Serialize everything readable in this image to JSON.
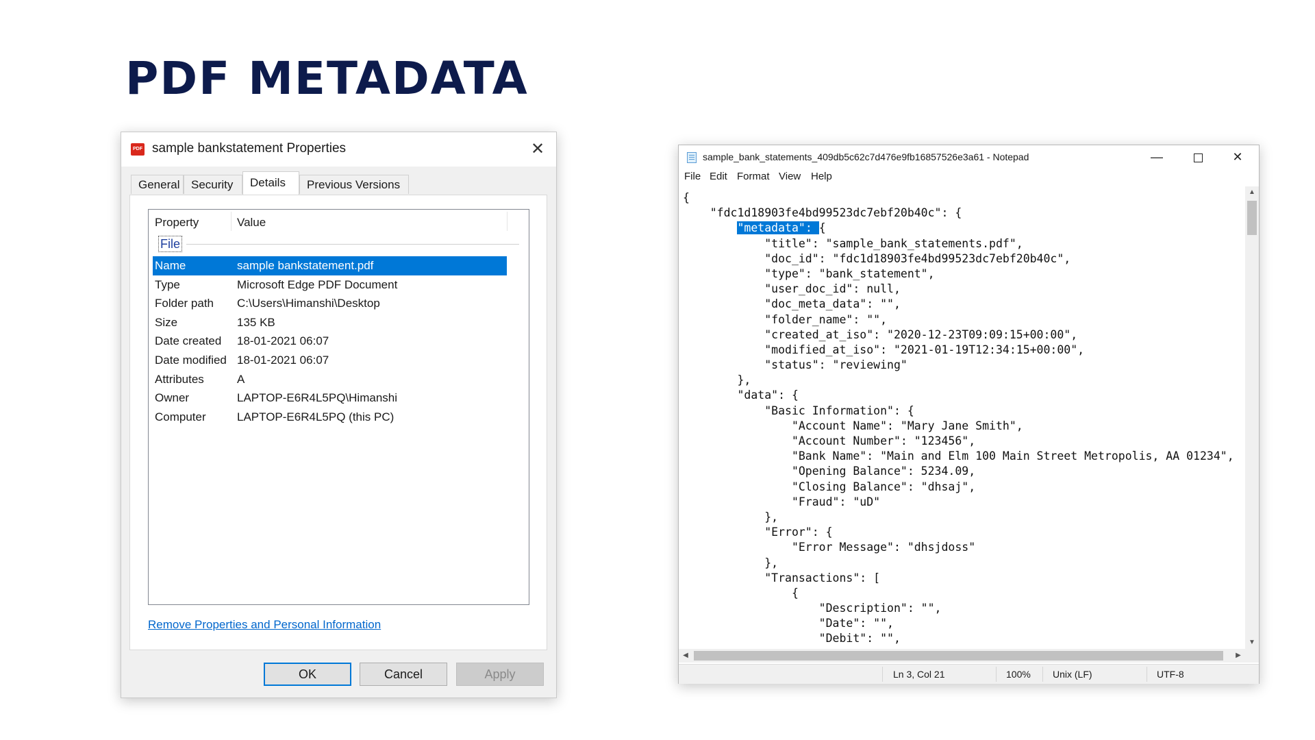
{
  "slide": {
    "title": "PDF METADATA"
  },
  "properties_dialog": {
    "icon_label": "PDF",
    "title": "sample bankstatement Properties",
    "close_glyph": "✕",
    "tabs": [
      "General",
      "Security",
      "Details",
      "Previous Versions"
    ],
    "active_tab": "Details",
    "columns": {
      "property": "Property",
      "value": "Value"
    },
    "group": "File",
    "rows": [
      {
        "key": "Name",
        "value": "sample bankstatement.pdf"
      },
      {
        "key": "Type",
        "value": "Microsoft Edge PDF Document"
      },
      {
        "key": "Folder path",
        "value": "C:\\Users\\Himanshi\\Desktop"
      },
      {
        "key": "Size",
        "value": "135 KB"
      },
      {
        "key": "Date created",
        "value": "18-01-2021 06:07"
      },
      {
        "key": "Date modified",
        "value": "18-01-2021 06:07"
      },
      {
        "key": "Attributes",
        "value": "A"
      },
      {
        "key": "Owner",
        "value": "LAPTOP-E6R4L5PQ\\Himanshi"
      },
      {
        "key": "Computer",
        "value": "LAPTOP-E6R4L5PQ (this PC)"
      }
    ],
    "selected_row": "Name",
    "remove_link": "Remove Properties and Personal Information",
    "buttons": {
      "ok": "OK",
      "cancel": "Cancel",
      "apply": "Apply"
    }
  },
  "notepad": {
    "title": "sample_bank_statements_409db5c62c7d476e9fb16857526e3a61 - Notepad",
    "window_controls": {
      "minimize": "—",
      "close": "✕"
    },
    "menu": [
      "File",
      "Edit",
      "Format",
      "View",
      "Help"
    ],
    "lines": [
      "{",
      "    \"fdc1d18903fe4bd99523dc7ebf20b40c\": {",
      "        \"metadata\": {",
      "            \"title\": \"sample_bank_statements.pdf\",",
      "            \"doc_id\": \"fdc1d18903fe4bd99523dc7ebf20b40c\",",
      "            \"type\": \"bank_statement\",",
      "            \"user_doc_id\": null,",
      "            \"doc_meta_data\": \"\",",
      "            \"folder_name\": \"\",",
      "            \"created_at_iso\": \"2020-12-23T09:09:15+00:00\",",
      "            \"modified_at_iso\": \"2021-01-19T12:34:15+00:00\",",
      "            \"status\": \"reviewing\"",
      "        },",
      "        \"data\": {",
      "            \"Basic Information\": {",
      "                \"Account Name\": \"Mary Jane Smith\",",
      "                \"Account Number\": \"123456\",",
      "                \"Bank Name\": \"Main and Elm 100 Main Street Metropolis, AA 01234\",",
      "                \"Opening Balance\": 5234.09,",
      "                \"Closing Balance\": \"dhsaj\",",
      "                \"Fraud\": \"uD\"",
      "            },",
      "            \"Error\": {",
      "                \"Error Message\": \"dhsjdoss\"",
      "            },",
      "            \"Transactions\": [",
      "                {",
      "                    \"Description\": \"\",",
      "                    \"Date\": \"\",",
      "                    \"Debit\": \"\","
    ],
    "selection": {
      "line": 2,
      "text": "\"metadata\": "
    },
    "status": {
      "position": "Ln 3, Col 21",
      "zoom": "100%",
      "line_endings": "Unix (LF)",
      "encoding": "UTF-8"
    },
    "scroll_glyphs": {
      "up": "▲",
      "down": "▼",
      "left": "◀",
      "right": "▶"
    }
  }
}
